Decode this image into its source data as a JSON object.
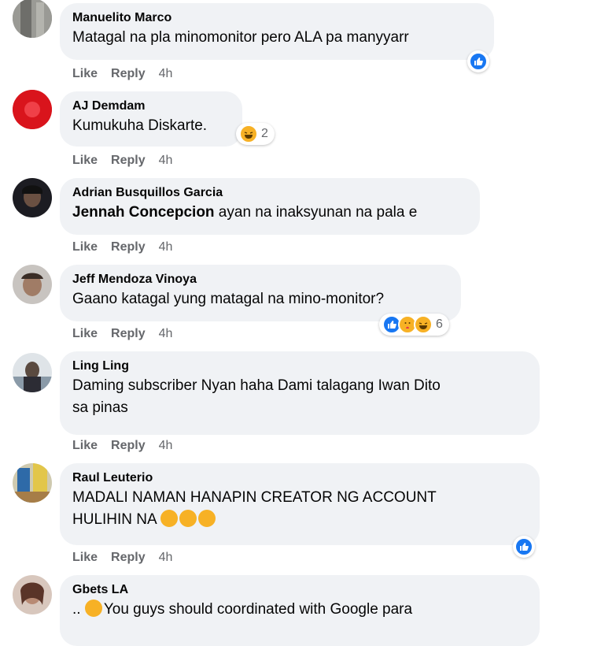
{
  "comments": [
    {
      "author": "Manuelito Marco",
      "text": "Matagal na pla minomonitor pero ALA pa manyyarr",
      "like": "Like",
      "reply": "Reply",
      "time": "4h"
    },
    {
      "author": "AJ Demdam",
      "text": "Kumukuha Diskarte.",
      "reaction_count": "2",
      "like": "Like",
      "reply": "Reply",
      "time": "4h"
    },
    {
      "author": "Adrian Busquillos Garcia",
      "mention": "Jennah Concepcion",
      "text": " ayan na inaksyunan na pala e",
      "like": "Like",
      "reply": "Reply",
      "time": "4h"
    },
    {
      "author": "Jeff Mendoza Vinoya",
      "text": "Gaano katagal yung matagal na mino-monitor?",
      "reaction_count": "6",
      "like": "Like",
      "reply": "Reply",
      "time": "4h"
    },
    {
      "author": "Ling Ling",
      "text_line1": "Daming subscriber Nyan haha Dami talagang Iwan Dito",
      "text_line2": "sa pinas",
      "like": "Like",
      "reply": "Reply",
      "time": "4h"
    },
    {
      "author": "Raul Leuterio",
      "text_line1": "MADALI NAMAN HANAPIN CREATOR NG ACCOUNT",
      "text_line2": "HULIHIN NA",
      "like": "Like",
      "reply": "Reply",
      "time": "4h"
    },
    {
      "author": "Gbets LA",
      "text_prefix": "..",
      "text": "You guys should coordinated with Google para"
    }
  ],
  "colors": {
    "like_blue": "#1877f2",
    "haha_yellow": "#f7b125",
    "bubble": "#f0f2f5",
    "meta_gray": "#65676b"
  }
}
